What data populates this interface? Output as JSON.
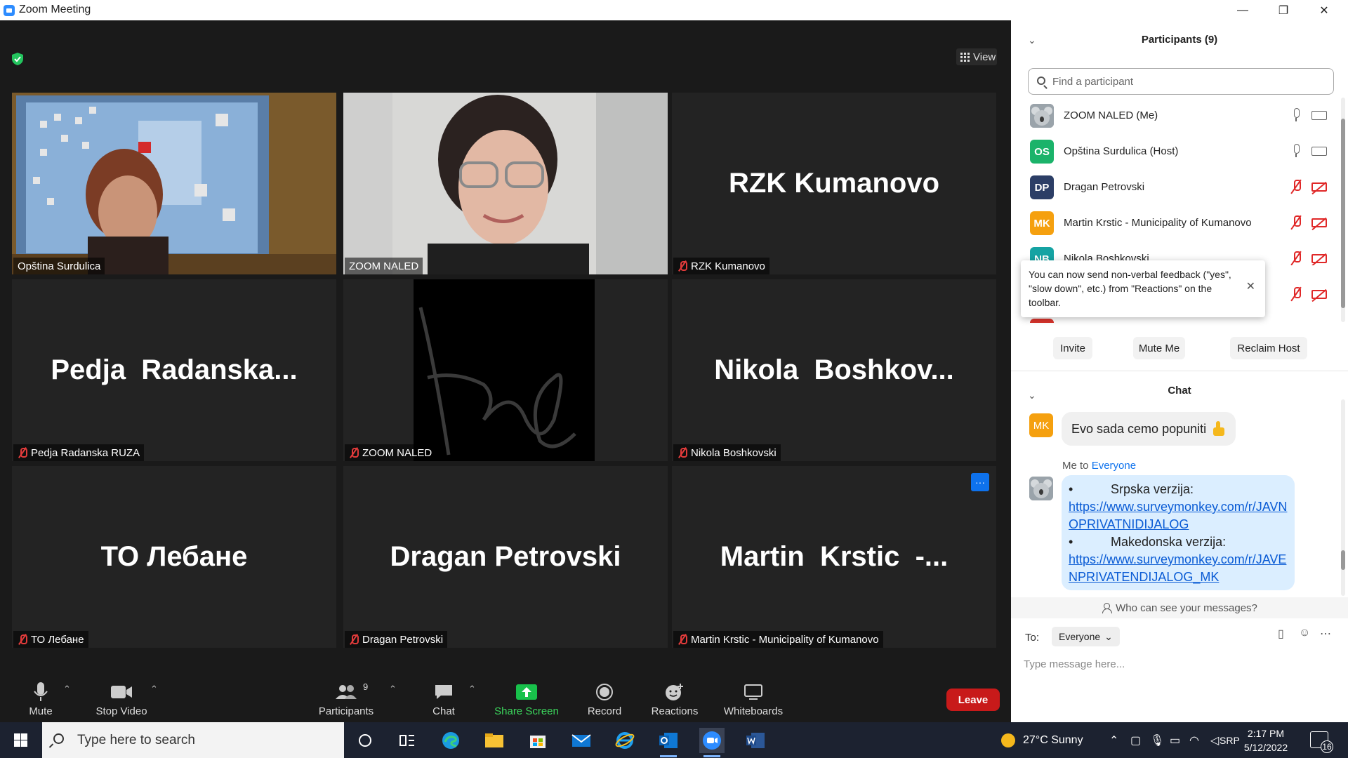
{
  "window": {
    "title": "Zoom Meeting",
    "controls": [
      "—",
      "❐",
      "✕"
    ]
  },
  "meeting": {
    "view_label": "View",
    "tiles": [
      {
        "name_big": "",
        "label": "Opština Surdulica",
        "muted": false,
        "video": "desk"
      },
      {
        "name_big": "",
        "label": "ZOOM NALED",
        "muted": false,
        "video": "face"
      },
      {
        "name_big": "RZK Kumanovo",
        "label": "RZK Kumanovo",
        "muted": true
      },
      {
        "name_big": "Pedja  Radanska...",
        "label": "Pedja Radanska RUZA",
        "muted": true
      },
      {
        "name_big": "",
        "label": "ZOOM NALED",
        "muted": true,
        "video": "signature"
      },
      {
        "name_big": "Nikola  Boshkov...",
        "label": "Nikola Boshkovski",
        "muted": true
      },
      {
        "name_big": "ТО Лебане",
        "label": "ТО Лебане",
        "muted": true
      },
      {
        "name_big": "Dragan Petrovski",
        "label": "Dragan Petrovski",
        "muted": true
      },
      {
        "name_big": "Martin  Krstic  -...",
        "label": "Martin Krstic - Municipality of Kumanovo",
        "muted": true
      }
    ],
    "more_options": "···"
  },
  "toolbar": {
    "mute": "Mute",
    "stop_video": "Stop Video",
    "participants": "Participants",
    "participants_count": "9",
    "chat": "Chat",
    "share_screen": "Share Screen",
    "record": "Record",
    "reactions": "Reactions",
    "whiteboards": "Whiteboards",
    "leave": "Leave"
  },
  "participants_panel": {
    "title": "Participants (9)",
    "search_placeholder": "Find a participant",
    "list": [
      {
        "initials": "",
        "name": "ZOOM NALED (Me)",
        "color": "#8a9299",
        "mic": "on",
        "cam": "on"
      },
      {
        "initials": "OS",
        "name": "Opština Surdulica (Host)",
        "color": "#1bb36a",
        "mic": "on",
        "cam": "on"
      },
      {
        "initials": "DP",
        "name": "Dragan Petrovski",
        "color": "#2c3e66",
        "mic": "off",
        "cam": "off"
      },
      {
        "initials": "MK",
        "name": "Martin Krstic - Municipality of Kumanovo",
        "color": "#f5a00f",
        "mic": "off",
        "cam": "off"
      },
      {
        "initials": "NB",
        "name": "Nikola Boshkovski",
        "color": "#15a3a3",
        "mic": "off",
        "cam": "off"
      },
      {
        "initials": "",
        "name": "",
        "color": "#d8342c",
        "mic": "off",
        "cam": "off"
      }
    ],
    "tooltip": "You can now send non-verbal feedback (\"yes\", \"slow down\", etc.) from \"Reactions\" on the toolbar.",
    "tooltip_close": "✕",
    "invite": "Invite",
    "mute_me": "Mute Me",
    "reclaim_host": "Reclaim Host"
  },
  "chat_panel": {
    "title": "Chat",
    "msg1_initials": "MK",
    "msg1_text": "Evo sada cemo popuniti",
    "meta_prefix": "Me to ",
    "meta_target": "Everyone",
    "msg2": {
      "item1_label": "Srpska verzija:",
      "item1_link": "https://www.surveymonkey.com/r/JAVNOPRIVATNIDIJALOG",
      "item2_label": "Makedonska verzija:",
      "item2_link": "https://www.surveymonkey.com/r/JAVENPRIVATENDIJALOG_MK"
    },
    "who_can_see": "Who can see your messages?",
    "to_label": "To:",
    "to_value": "Everyone",
    "input_placeholder": "Type message here..."
  },
  "taskbar": {
    "search_placeholder": "Type here to search",
    "weather": "27°C  Sunny",
    "lang": "SRP",
    "time": "2:17 PM",
    "date": "5/12/2022",
    "notifications": "16"
  }
}
